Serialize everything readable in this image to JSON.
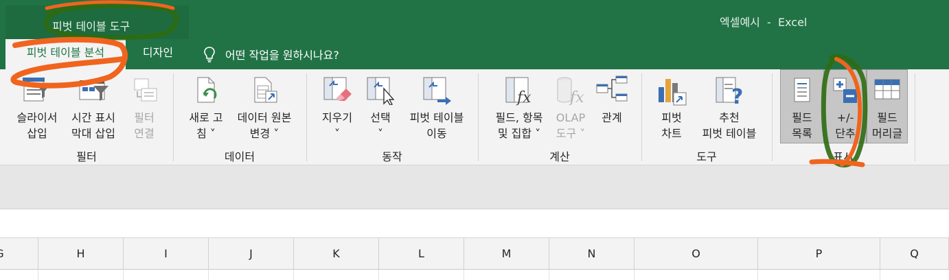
{
  "title_bar": {
    "context_group": "피벗 테이블 도구",
    "app_title": "엑셀예시  -  Excel"
  },
  "tabs": [
    {
      "label": "피벗 테이블 분석",
      "active": true
    },
    {
      "label": "디자인",
      "active": false
    }
  ],
  "tell_me": {
    "text": "어떤 작업을 원하시나요?",
    "icon": "lightbulb-icon"
  },
  "ribbon": {
    "groups": {
      "filter": "필터",
      "data": "데이터",
      "actions": "동작",
      "calculations": "계산",
      "tools": "도구",
      "show": "표시"
    },
    "buttons": {
      "insert_slicer": "슬라이서\n삽입",
      "insert_timeline": "시간 표시\n막대 삽입",
      "filter_connections": "필터\n연결",
      "refresh": "새로 고\n침 ˅",
      "change_source": "데이터 원본\n변경 ˅",
      "clear": "지우기\n˅",
      "select": "선택\n˅",
      "move_pivot": "피벗 테이블\n이동",
      "fields_items_sets": "필드, 항목\n및 집합 ˅",
      "olap_tools": "OLAP\n도구 ˅",
      "relationships": "관계",
      "pivot_chart": "피벗\n차트",
      "recommended": "추천\n피벗 테이블",
      "field_list": "필드\n목록",
      "expand_collapse": "+/-\n단추",
      "field_headers": "필드\n머리글"
    }
  },
  "columns": [
    "G",
    "H",
    "I",
    "J",
    "K",
    "L",
    "M",
    "N",
    "O",
    "P",
    "Q"
  ],
  "colors": {
    "accent": "#217346",
    "annotation_orange": "#f0641e",
    "annotation_green": "#2f6b12"
  }
}
